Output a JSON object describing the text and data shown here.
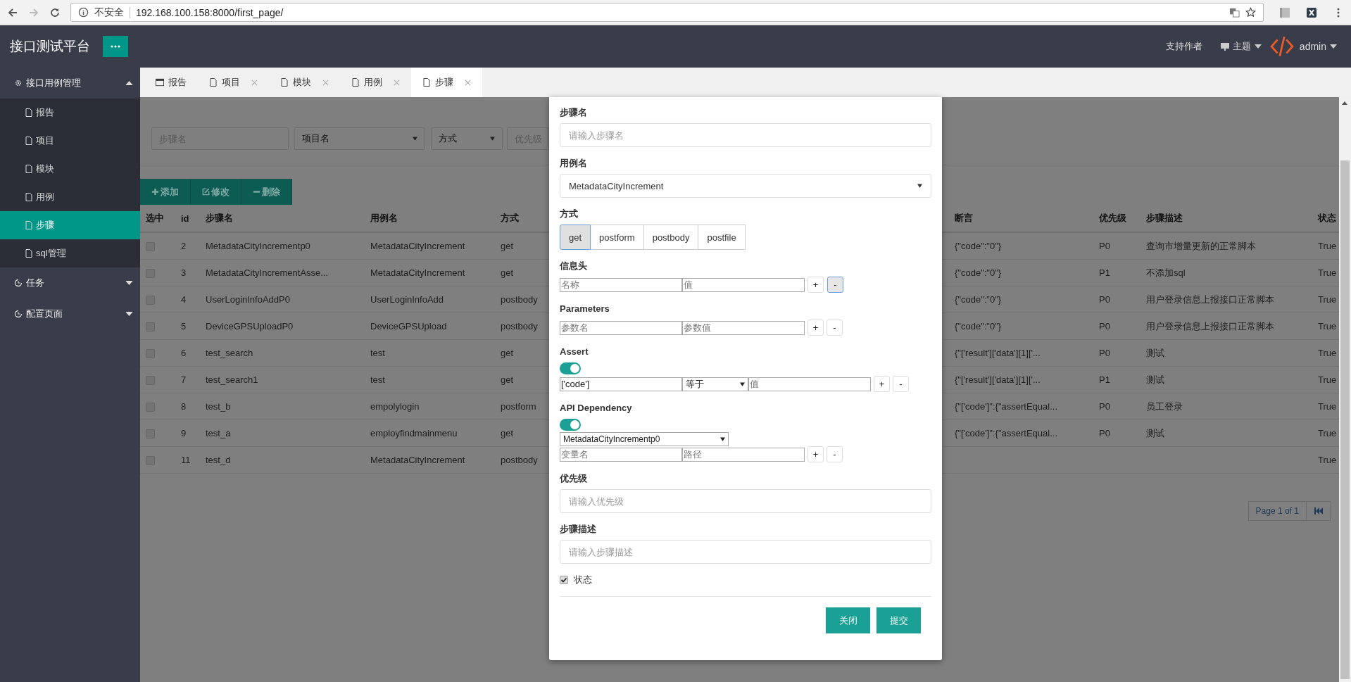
{
  "browser": {
    "security": "不安全",
    "url": "192.168.100.158:8000/first_page/"
  },
  "header": {
    "title": "接口测试平台",
    "support": "支持作者",
    "theme": "主题",
    "user": "admin"
  },
  "sidebar": {
    "groups": [
      {
        "label": "接口用例管理",
        "kind": "gear",
        "expanded": true,
        "children": [
          {
            "label": "报告",
            "selected": false
          },
          {
            "label": "项目",
            "selected": false
          },
          {
            "label": "模块",
            "selected": false
          },
          {
            "label": "用例",
            "selected": false
          },
          {
            "label": "步骤",
            "selected": true
          },
          {
            "label": "sql管理",
            "selected": false
          }
        ]
      },
      {
        "label": "任务",
        "kind": "clock",
        "expanded": false
      },
      {
        "label": "配置页面",
        "kind": "clock",
        "expanded": false
      }
    ]
  },
  "tabs": [
    {
      "label": "报告",
      "kind": "window",
      "closable": false,
      "selected": false
    },
    {
      "label": "项目",
      "kind": "file",
      "closable": true,
      "selected": false
    },
    {
      "label": "模块",
      "kind": "file",
      "closable": true,
      "selected": false
    },
    {
      "label": "用例",
      "kind": "file",
      "closable": true,
      "selected": false
    },
    {
      "label": "步骤",
      "kind": "file",
      "closable": true,
      "selected": true
    }
  ],
  "filters": [
    {
      "kind": "input",
      "placeholder": "步骤名"
    },
    {
      "kind": "select",
      "value": "项目名"
    },
    {
      "kind": "select",
      "value": "方式"
    },
    {
      "kind": "input",
      "placeholder": "优先级"
    }
  ],
  "toolbar": [
    {
      "label": "添加",
      "kind": "add"
    },
    {
      "label": "修改",
      "kind": "edit"
    },
    {
      "label": "删除",
      "kind": "delete"
    }
  ],
  "table": {
    "columns": [
      "选中",
      "id",
      "步骤名",
      "用例名",
      "方式",
      "断言",
      "优先级",
      "步骤描述",
      "状态"
    ],
    "rows": [
      {
        "selected": false,
        "id": "2",
        "step": "MetadataCityIncrementp0",
        "case": "MetadataCityIncrement",
        "method": "get",
        "assertion": "{\"code\":\"0\"}",
        "priority": "P0",
        "desc": "查询市增量更新的正常脚本",
        "status": "True"
      },
      {
        "selected": false,
        "id": "3",
        "step": "MetadataCityIncrementAsse...",
        "case": "MetadataCityIncrement",
        "method": "get",
        "assertion": "{\"code\":\"0\"}",
        "priority": "P1",
        "desc": "不添加sql",
        "status": "True"
      },
      {
        "selected": false,
        "id": "4",
        "step": "UserLoginInfoAddP0",
        "case": "UserLoginInfoAdd",
        "method": "postbody",
        "assertion": "{\"code\":\"0\"}",
        "priority": "P0",
        "desc": "用户登录信息上报接口正常脚本",
        "status": "True"
      },
      {
        "selected": false,
        "id": "5",
        "step": "DeviceGPSUploadP0",
        "case": "DeviceGPSUpload",
        "method": "postbody",
        "assertion": "{\"code\":\"0\"}",
        "priority": "P0",
        "desc": "用户登录信息上报接口正常脚本",
        "status": "True"
      },
      {
        "selected": false,
        "id": "6",
        "step": "test_search",
        "case": "test",
        "method": "get",
        "assertion": "{\"['result']['data'][1]['...",
        "priority": "P0",
        "desc": "测试",
        "status": "True"
      },
      {
        "selected": false,
        "id": "7",
        "step": "test_search1",
        "case": "test",
        "method": "get",
        "assertion": "{\"['result']['data'][1]['...",
        "priority": "P1",
        "desc": "测试",
        "status": "True"
      },
      {
        "selected": false,
        "id": "8",
        "step": "test_b",
        "case": "empolylogin",
        "method": "postform",
        "assertion": "{\"['code']\":{\"assertEqual...",
        "priority": "P0",
        "desc": "员工登录",
        "status": "True"
      },
      {
        "selected": false,
        "id": "9",
        "step": "test_a",
        "case": "employfindmainmenu",
        "method": "get",
        "assertion": "{\"['code']\":{\"assertEqual...",
        "priority": "P0",
        "desc": "测试",
        "status": "True"
      },
      {
        "selected": false,
        "id": "11",
        "step": "test_d",
        "case": "MetadataCityIncrement",
        "method": "postbody",
        "status": "True"
      }
    ]
  },
  "pagination": {
    "label": "Page 1 of 1"
  },
  "modal": {
    "step_name": {
      "label": "步骤名",
      "placeholder": "请输入步骤名"
    },
    "case_name": {
      "label": "用例名",
      "value": "MetadataCityIncrement"
    },
    "method": {
      "label": "方式",
      "options": [
        {
          "label": "get",
          "selected": true
        },
        {
          "label": "postform",
          "selected": false
        },
        {
          "label": "postbody",
          "selected": false
        },
        {
          "label": "postfile",
          "selected": false
        }
      ]
    },
    "headers": {
      "label": "信息头",
      "name_placeholder": "名称",
      "value_placeholder": "值",
      "add": "+",
      "remove": "-"
    },
    "parameters": {
      "label": "Parameters",
      "name_placeholder": "参数名",
      "value_placeholder": "参数值",
      "add": "+",
      "remove": "-"
    },
    "assert": {
      "label": "Assert",
      "on": true,
      "path": "['code']",
      "operator": "等于",
      "value_placeholder": "值",
      "add": "+",
      "remove": "-"
    },
    "dependency": {
      "label": "API Dependency",
      "on": true,
      "api": "MetadataCityIncrementp0",
      "name_placeholder": "变量名",
      "path_placeholder": "路径",
      "add": "+",
      "remove": "-"
    },
    "priority": {
      "label": "优先级",
      "placeholder": "请输入优先级"
    },
    "description": {
      "label": "步骤描述",
      "placeholder": "请输入步骤描述"
    },
    "status": {
      "label": "状态",
      "checked": true
    },
    "buttons": [
      "关闭",
      "提交"
    ]
  }
}
